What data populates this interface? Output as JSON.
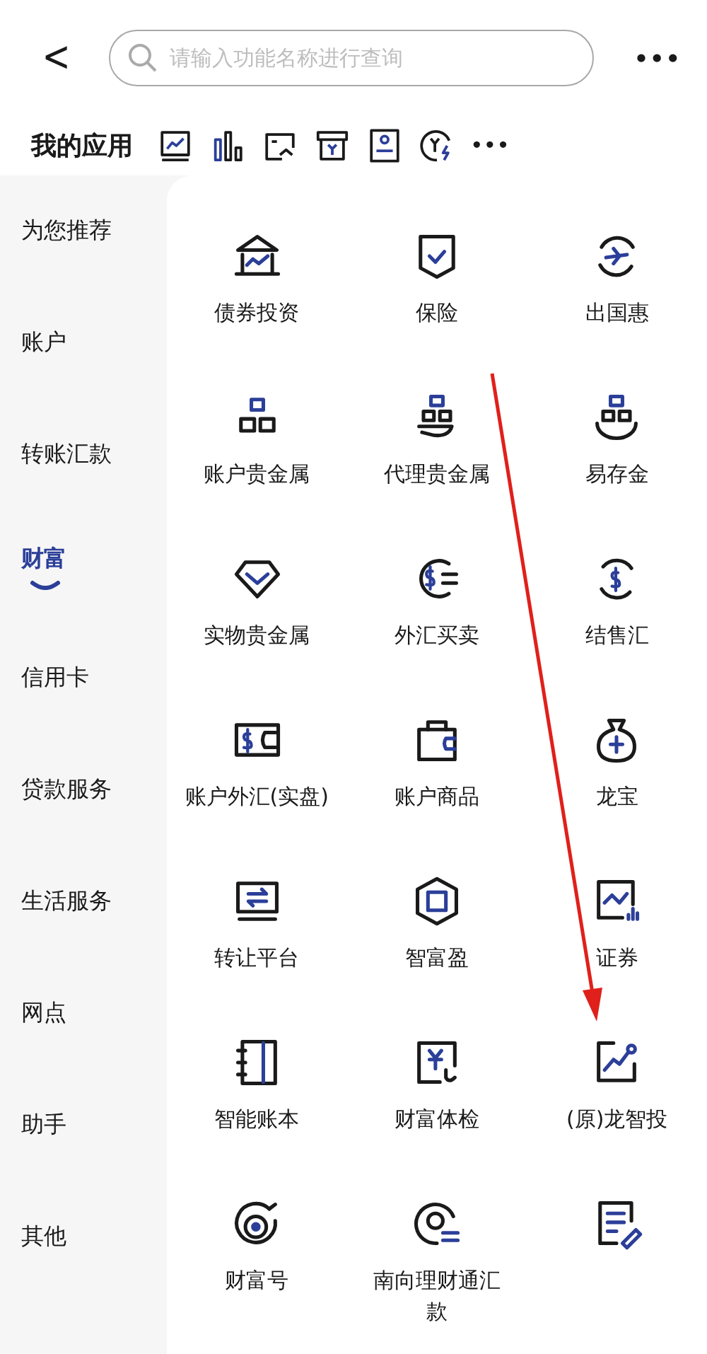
{
  "header": {
    "back": "<",
    "search": {
      "placeholder": "请输入功能名称进行查询"
    },
    "more": "•••"
  },
  "my_apps": {
    "title": "我的应用",
    "more": "•••"
  },
  "sidebar": {
    "items": [
      {
        "label": "为您推荐",
        "selected": false
      },
      {
        "label": "账户",
        "selected": false
      },
      {
        "label": "转账汇款",
        "selected": false
      },
      {
        "label": "财富",
        "selected": true
      },
      {
        "label": "信用卡",
        "selected": false
      },
      {
        "label": "贷款服务",
        "selected": false
      },
      {
        "label": "生活服务",
        "selected": false
      },
      {
        "label": "网点",
        "selected": false
      },
      {
        "label": "助手",
        "selected": false
      },
      {
        "label": "其他",
        "selected": false
      }
    ]
  },
  "grid": {
    "items": [
      {
        "kind": "labeled",
        "label": "债券投资"
      },
      {
        "kind": "labeled",
        "label": "保险"
      },
      {
        "kind": "labeled",
        "label": "出国惠"
      },
      {
        "kind": "labeled",
        "label": "账户贵金属"
      },
      {
        "kind": "labeled",
        "label": "代理贵金属"
      },
      {
        "kind": "labeled",
        "label": "易存金"
      },
      {
        "kind": "labeled",
        "label": "实物贵金属"
      },
      {
        "kind": "labeled",
        "label": "外汇买卖"
      },
      {
        "kind": "labeled",
        "label": "结售汇"
      },
      {
        "kind": "labeled",
        "label": "账户外汇(实盘)"
      },
      {
        "kind": "labeled",
        "label": "账户商品"
      },
      {
        "kind": "labeled",
        "label": "龙宝"
      },
      {
        "kind": "labeled",
        "label": "转让平台"
      },
      {
        "kind": "labeled",
        "label": "智富盈"
      },
      {
        "kind": "labeled",
        "label": "证券"
      },
      {
        "kind": "labeled",
        "label": "智能账本"
      },
      {
        "kind": "labeled",
        "label": "财富体检"
      },
      {
        "kind": "labeled",
        "label": "(原)龙智投"
      },
      {
        "kind": "labeled",
        "label": "财富号"
      },
      {
        "kind": "labeled",
        "label": "南向理财通汇款"
      },
      {
        "kind": "icon"
      }
    ]
  }
}
